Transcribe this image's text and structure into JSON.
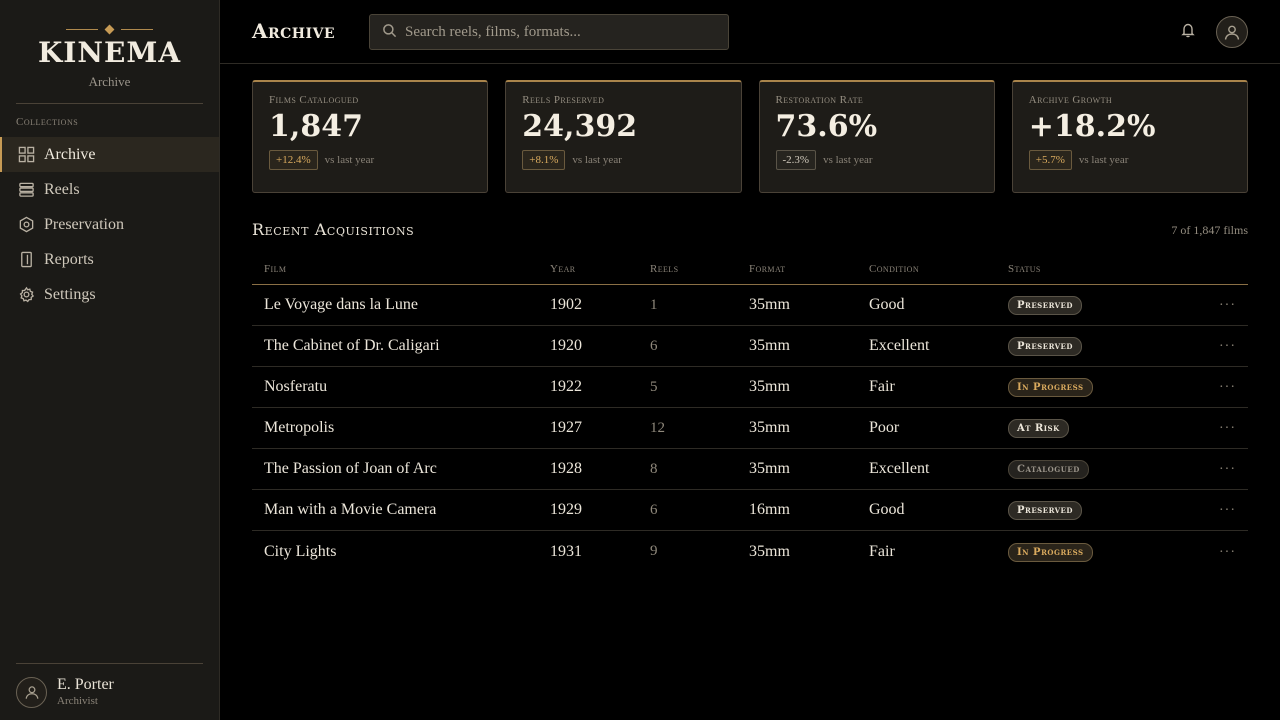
{
  "brand": {
    "name": "KINEMA",
    "subtitle": "Archive"
  },
  "sidebar": {
    "section_label": "Collections",
    "items": [
      {
        "label": "Archive",
        "icon": "grid-icon",
        "active": true
      },
      {
        "label": "Reels",
        "icon": "stack-icon",
        "active": false
      },
      {
        "label": "Preservation",
        "icon": "hexagon-icon",
        "active": false
      },
      {
        "label": "Reports",
        "icon": "document-icon",
        "active": false
      },
      {
        "label": "Settings",
        "icon": "gear-icon",
        "active": false
      }
    ],
    "user": {
      "name": "E. Porter",
      "role": "Archivist"
    }
  },
  "header": {
    "title": "Archive",
    "search_placeholder": "Search reels, films, formats..."
  },
  "stats": [
    {
      "label": "Films Catalogued",
      "value": "1,847",
      "delta": "+12.4%",
      "note": "vs last year",
      "positive": true
    },
    {
      "label": "Reels Preserved",
      "value": "24,392",
      "delta": "+8.1%",
      "note": "vs last year",
      "positive": true
    },
    {
      "label": "Restoration Rate",
      "value": "73.6%",
      "delta": "-2.3%",
      "note": "vs last year",
      "positive": false
    },
    {
      "label": "Archive Growth",
      "value": "+18.2%",
      "delta": "+5.7%",
      "note": "vs last year",
      "positive": true
    }
  ],
  "acquisitions": {
    "title": "Recent Acquisitions",
    "count": "7 of 1,847 films",
    "columns": [
      "Film",
      "Year",
      "Reels",
      "Format",
      "Condition",
      "Status"
    ],
    "rows": [
      {
        "film": "Le Voyage dans la Lune",
        "year": "1902",
        "reels": "1",
        "format": "35mm",
        "condition": "Good",
        "status": "Preserved",
        "status_kind": "preserved"
      },
      {
        "film": "The Cabinet of Dr. Caligari",
        "year": "1920",
        "reels": "6",
        "format": "35mm",
        "condition": "Excellent",
        "status": "Preserved",
        "status_kind": "preserved"
      },
      {
        "film": "Nosferatu",
        "year": "1922",
        "reels": "5",
        "format": "35mm",
        "condition": "Fair",
        "status": "In Progress",
        "status_kind": "progress"
      },
      {
        "film": "Metropolis",
        "year": "1927",
        "reels": "12",
        "format": "35mm",
        "condition": "Poor",
        "status": "At Risk",
        "status_kind": "risk"
      },
      {
        "film": "The Passion of Joan of Arc",
        "year": "1928",
        "reels": "8",
        "format": "35mm",
        "condition": "Excellent",
        "status": "Catalogued",
        "status_kind": "catalogued"
      },
      {
        "film": "Man with a Movie Camera",
        "year": "1929",
        "reels": "6",
        "format": "16mm",
        "condition": "Good",
        "status": "Preserved",
        "status_kind": "preserved"
      },
      {
        "film": "City Lights",
        "year": "1931",
        "reels": "9",
        "format": "35mm",
        "condition": "Fair",
        "status": "In Progress",
        "status_kind": "progress"
      }
    ],
    "row_menu": "···"
  },
  "colors": {
    "accent": "#c79b55",
    "background": "#000000",
    "sidebar": "#1b1a17"
  }
}
